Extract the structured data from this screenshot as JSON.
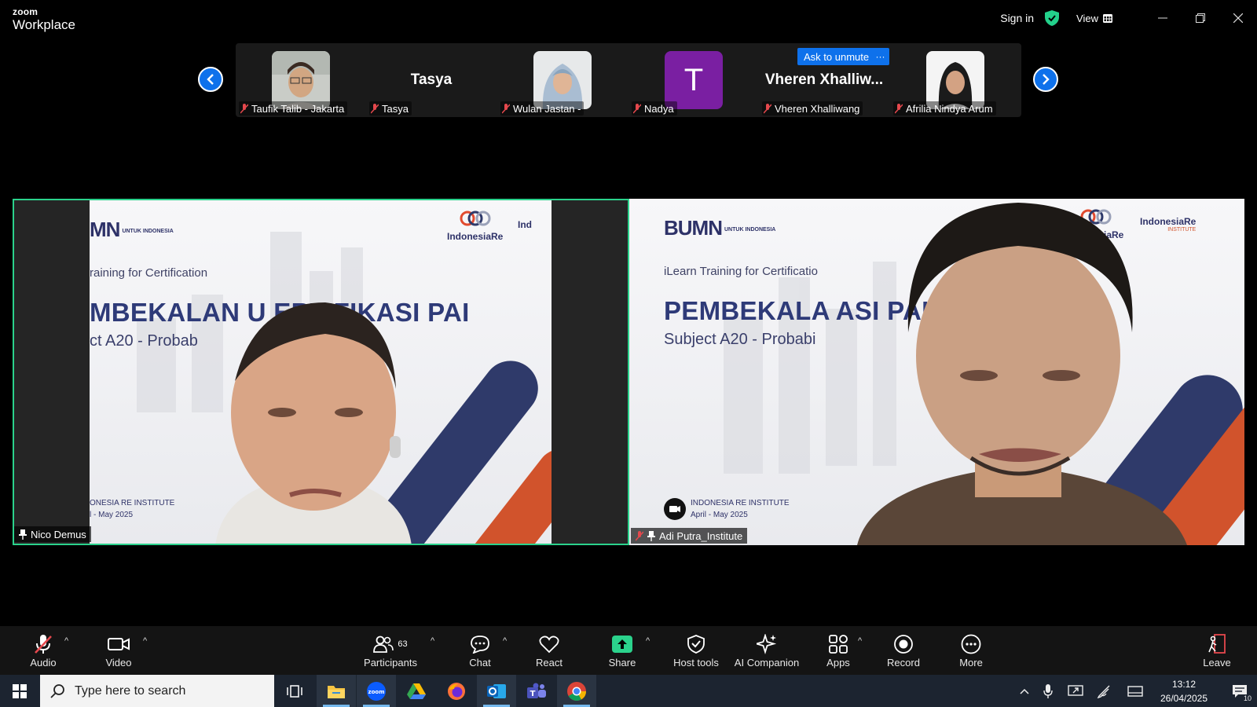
{
  "titlebar": {
    "brand_top": "zoom",
    "brand_bottom": "Workplace",
    "sign_in": "Sign in",
    "view": "View"
  },
  "gallery": {
    "tiles": [
      {
        "label": "Taufik Talib - Jakarta",
        "muted": true,
        "display": "photo"
      },
      {
        "label": "Tasya",
        "muted": true,
        "display": "name",
        "big_name": "Tasya"
      },
      {
        "label": "Wulan Jastan -",
        "muted": true,
        "display": "photo"
      },
      {
        "label": "Nadya",
        "muted": true,
        "display": "letter",
        "letter": "T"
      },
      {
        "label": "Vheren Xhalliwang",
        "muted": true,
        "display": "name",
        "big_name": "Vheren  Xhalliw..."
      },
      {
        "label": "Afrilia Nindya Arum",
        "muted": true,
        "display": "photo"
      }
    ],
    "ask_to_unmute": "Ask to unmute",
    "more_dots": "···"
  },
  "videos": {
    "left": {
      "name": "Nico Demus",
      "pinned": true,
      "muted": false,
      "slide": {
        "logo_left": "MN",
        "logo_left_small": "UNTUK INDONESIA",
        "logo_right": "IndonesiaRe",
        "logo_right2": "Ind",
        "ilearn": "raining for Certification",
        "title": "MBEKALAN U    ERTIFIKASI PAI",
        "subject": "ct A20 - Probab",
        "institute_line1": "ONESIA RE INSTITUTE",
        "institute_line2": "l - May 2025"
      }
    },
    "right": {
      "name": "Adi Putra_Institute",
      "pinned": true,
      "muted": true,
      "slide": {
        "logo_left": "BUMN",
        "logo_left_small": "UNTUK INDONESIA",
        "logo_right": "IndonesiaRe",
        "logo_right2": "IndonesiaRe",
        "logo_right2_sub": "INSTITUTE",
        "ilearn": "iLearn Training for Certificatio",
        "title": "PEMBEKALA                ASI PAI",
        "subject": "Subject A20 - Probabi",
        "institute_line1": "INDONESIA RE INSTITUTE",
        "institute_line2": "April - May 2025"
      }
    }
  },
  "toolbar": {
    "audio": "Audio",
    "video": "Video",
    "participants": "Participants",
    "participants_count": "63",
    "chat": "Chat",
    "react": "React",
    "share": "Share",
    "host_tools": "Host tools",
    "ai_companion": "AI Companion",
    "apps": "Apps",
    "record": "Record",
    "more": "More",
    "leave": "Leave"
  },
  "taskbar": {
    "search_placeholder": "Type here to search",
    "time": "13:12",
    "date": "26/04/2025",
    "notification_count": "10"
  },
  "colors": {
    "accent_blue": "#0e71eb",
    "active_speaker_border": "#2bd28c",
    "share_green": "#2bd28c",
    "muted_red": "#e5484d"
  }
}
